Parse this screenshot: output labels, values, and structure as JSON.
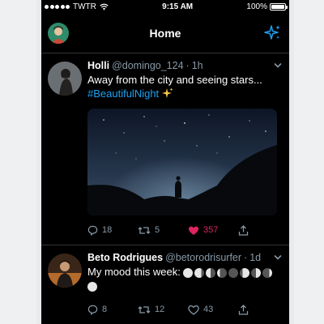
{
  "status": {
    "carrier": "TWTR",
    "time": "9:15 AM",
    "battery": "100%",
    "battery_level": 1.0
  },
  "header": {
    "title": "Home"
  },
  "tweets": [
    {
      "name": "Holli",
      "handle": "@domingo_124",
      "sep": "·",
      "time": "1h",
      "text": "Away from the city and seeing stars...",
      "hashtag": "#BeautifulNight",
      "replies": "18",
      "retweets": "5",
      "likes": "357",
      "liked": true
    },
    {
      "name": "Beto Rodrigues",
      "handle": "@betorodrisurfer",
      "sep": "·",
      "time": "1d",
      "text": "My mood this week:",
      "replies": "8",
      "retweets": "12",
      "likes": "43",
      "liked": false
    }
  ],
  "colors": {
    "accent": "#1da1f2",
    "like": "#e0245e",
    "muted": "#8899a6",
    "background": "#000000"
  },
  "icons": [
    "wifi-icon",
    "sparkle-icon",
    "chevron-down-icon",
    "reply-icon",
    "retweet-icon",
    "heart-icon",
    "share-icon",
    "sparkles-emoji-icon",
    "moon-phase-icon"
  ]
}
